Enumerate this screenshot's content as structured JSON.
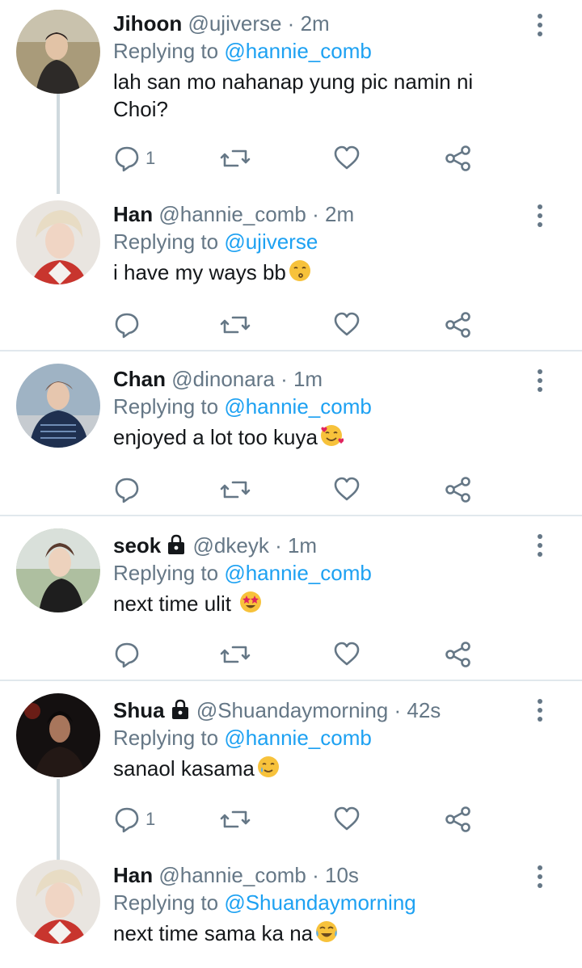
{
  "colors": {
    "link": "#1da1f2",
    "muted": "#657786",
    "text": "#14171a",
    "divider": "#e1e8ed"
  },
  "tweets": [
    {
      "name": "Jihoon",
      "handle": "@ujiverse",
      "dot": "·",
      "time": "2m",
      "reply_prefix": "Replying to",
      "reply_to": "@hannie_comb",
      "text": "lah san mo nahanap yung pic namin ni Choi?",
      "reply_count": "1",
      "locked": false,
      "emoji": ""
    },
    {
      "name": "Han",
      "handle": "@hannie_comb",
      "dot": "·",
      "time": "2m",
      "reply_prefix": "Replying to",
      "reply_to": "@ujiverse",
      "text": "i have my ways bb",
      "reply_count": "",
      "locked": false,
      "emoji": "kissing-face-emoji"
    },
    {
      "name": "Chan",
      "handle": "@dinonara",
      "dot": "·",
      "time": "1m",
      "reply_prefix": "Replying to",
      "reply_to": "@hannie_comb",
      "text": "enjoyed a lot too kuya",
      "reply_count": "",
      "locked": false,
      "emoji": "smiling-face-with-hearts-emoji"
    },
    {
      "name": "seok",
      "handle": "@dkeyk",
      "dot": "·",
      "time": "1m",
      "reply_prefix": "Replying to",
      "reply_to": "@hannie_comb",
      "text": "next time ulit",
      "reply_count": "",
      "locked": true,
      "emoji": "star-struck-emoji"
    },
    {
      "name": "Shua",
      "handle": "@Shuandaymorning",
      "dot": "·",
      "time": "42s",
      "reply_prefix": "Replying to",
      "reply_to": "@hannie_comb",
      "text": "sanaol kasama",
      "reply_count": "1",
      "locked": true,
      "emoji": "smiling-face-with-tear-emoji"
    },
    {
      "name": "Han",
      "handle": "@hannie_comb",
      "dot": "·",
      "time": "10s",
      "reply_prefix": "Replying to",
      "reply_to": "@Shuandaymorning",
      "text": "next time sama ka na",
      "reply_count": "",
      "locked": false,
      "emoji": "tears-of-joy-emoji"
    }
  ]
}
